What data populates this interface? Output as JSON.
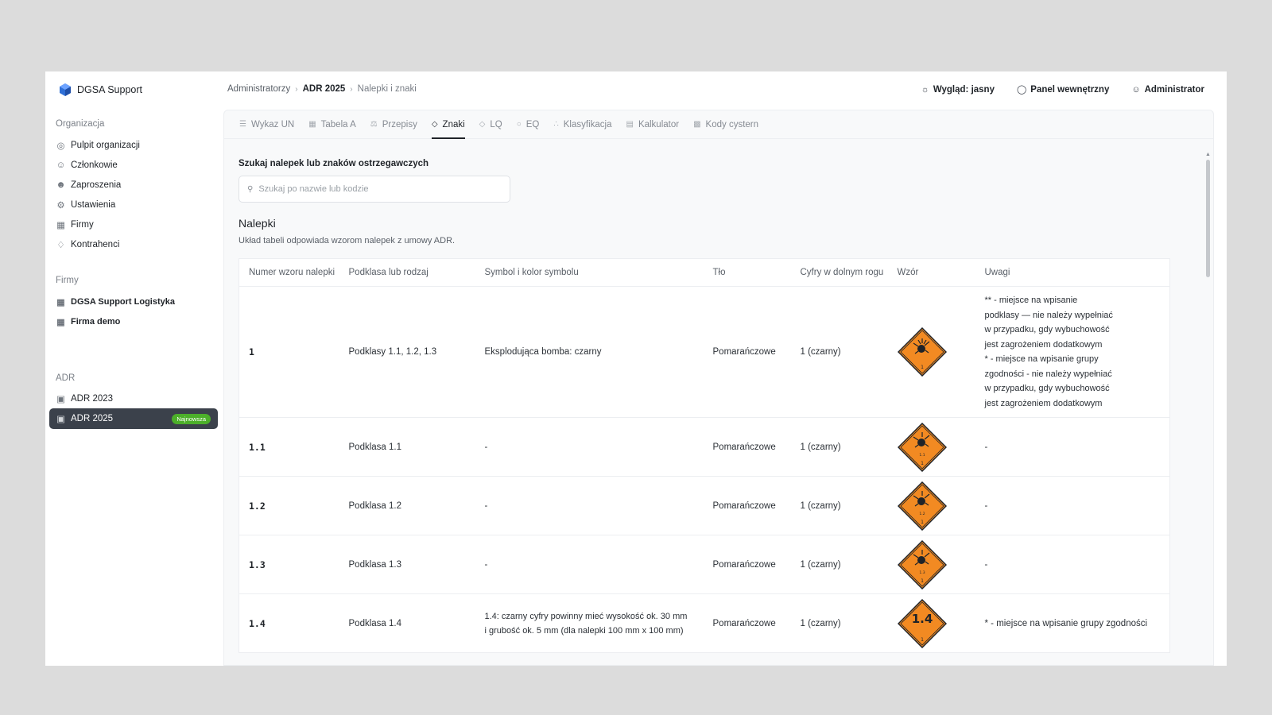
{
  "brand": {
    "name": "DGSA Support"
  },
  "sidebar": {
    "group_org": "Organizacja",
    "org_items": [
      {
        "label": "Pulpit organizacji",
        "icon": "dashboard-icon"
      },
      {
        "label": "Członkowie",
        "icon": "users-icon"
      },
      {
        "label": "Zaproszenia",
        "icon": "invite-icon"
      },
      {
        "label": "Ustawienia",
        "icon": "gear-icon"
      },
      {
        "label": "Firmy",
        "icon": "building-icon"
      },
      {
        "label": "Kontrahenci",
        "icon": "handshake-icon"
      }
    ],
    "group_firms": "Firmy",
    "firm_items": [
      {
        "label": "DGSA Support Logistyka",
        "icon": "building-icon"
      },
      {
        "label": "Firma demo",
        "icon": "building-icon"
      }
    ],
    "group_adr": "ADR",
    "adr_items": [
      {
        "label": "ADR 2023",
        "icon": "document-icon"
      },
      {
        "label": "ADR 2025",
        "icon": "document-icon",
        "badge": "Najnowsza",
        "active": true
      }
    ]
  },
  "breadcrumb": {
    "part1": "Administratorzy",
    "part2": "ADR 2025",
    "part3": "Nalepki i znaki"
  },
  "header": {
    "theme": "Wygląd: jasny",
    "panel": "Panel wewnętrzny",
    "user": "Administrator"
  },
  "tabs": [
    {
      "label": "Wykaz UN",
      "icon": "list-icon"
    },
    {
      "label": "Tabela A",
      "icon": "table-icon"
    },
    {
      "label": "Przepisy",
      "icon": "scale-icon"
    },
    {
      "label": "Znaki",
      "icon": "diamond-icon",
      "active": true
    },
    {
      "label": "LQ",
      "icon": "diamond-icon"
    },
    {
      "label": "EQ",
      "icon": "circle-icon"
    },
    {
      "label": "Klasyfikacja",
      "icon": "share-icon"
    },
    {
      "label": "Kalkulator",
      "icon": "calculator-icon"
    },
    {
      "label": "Kody cystern",
      "icon": "truck-icon"
    }
  ],
  "search": {
    "label": "Szukaj nalepek lub znaków ostrzegawczych",
    "placeholder": "Szukaj po nazwie lub kodzie",
    "value": ""
  },
  "section": {
    "title": "Nalepki",
    "desc": "Układ tabeli odpowiada wzorom nalepek z umowy ADR."
  },
  "table": {
    "headers": [
      "Numer wzoru nalepki",
      "Podklasa lub rodzaj",
      "Symbol i kolor symbolu",
      "Tło",
      "Cyfry w dolnym rogu",
      "Wzór",
      "Uwagi"
    ],
    "rows": [
      {
        "num": "1",
        "sub": "Podklasy 1.1, 1.2, 1.3",
        "symbol": "Eksplodująca bomba: czarny",
        "bg": "Pomarańczowe",
        "digits": "1 (czarny)",
        "pattern": "bomb",
        "pattern_text": "",
        "notes": [
          "** - miejsce na wpisanie",
          "podklasy — nie należy wypełniać",
          "w przypadku, gdy wybuchowość",
          "jest zagrożeniem dodatkowym",
          "* - miejsce na wpisanie grupy",
          "zgodności - nie należy wypełniać",
          "w przypadku, gdy wybuchowość",
          "jest zagrożeniem dodatkowym"
        ]
      },
      {
        "num": "1.1",
        "sub": "Podklasa 1.1",
        "symbol": "-",
        "bg": "Pomarańczowe",
        "digits": "1 (czarny)",
        "pattern": "bomb",
        "pattern_text": "1.1",
        "notes": [
          "-"
        ]
      },
      {
        "num": "1.2",
        "sub": "Podklasa 1.2",
        "symbol": "-",
        "bg": "Pomarańczowe",
        "digits": "1 (czarny)",
        "pattern": "bomb",
        "pattern_text": "1.2",
        "notes": [
          "-"
        ]
      },
      {
        "num": "1.3",
        "sub": "Podklasa 1.3",
        "symbol": "-",
        "bg": "Pomarańczowe",
        "digits": "1 (czarny)",
        "pattern": "bomb",
        "pattern_text": "1.3",
        "notes": [
          "-"
        ]
      },
      {
        "num": "1.4",
        "sub": "Podklasa 1.4",
        "symbol": "1.4: czarny cyfry powinny mieć wysokość ok. 30 mm i grubość ok. 5 mm (dla nalepki 100 mm x 100 mm)",
        "bg": "Pomarańczowe",
        "digits": "1 (czarny)",
        "pattern": "number",
        "pattern_text": "1.4",
        "notes": [
          "* - miejsce na wpisanie grupy zgodności"
        ]
      }
    ]
  },
  "colors": {
    "accent": "#3b414b",
    "badge": "#4caf2a",
    "label_orange": "#f28a22"
  }
}
